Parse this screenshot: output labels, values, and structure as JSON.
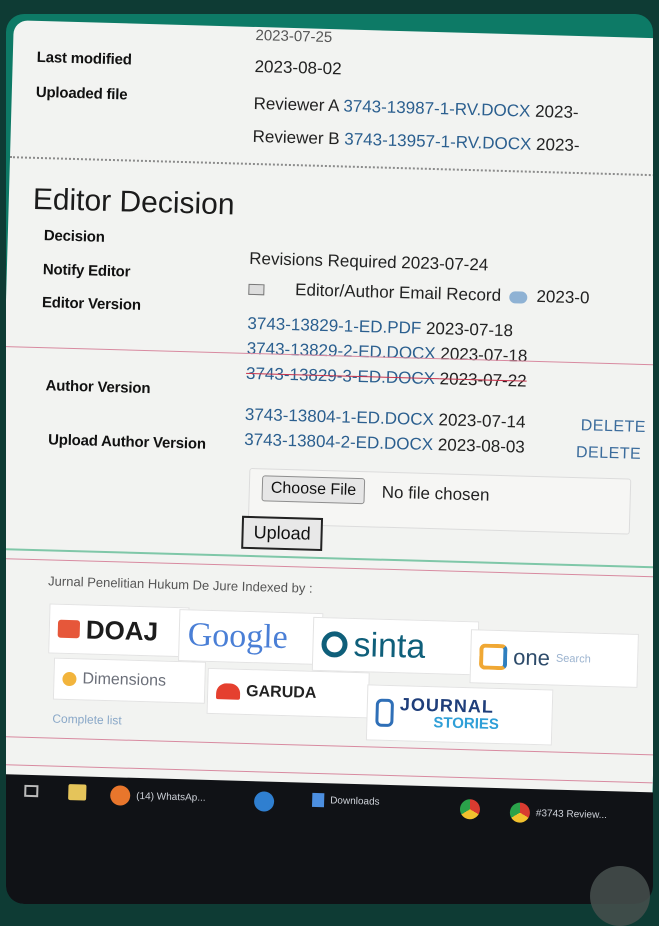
{
  "details": {
    "top_cut_date": "2023-07-25",
    "last_modified_label": "Last modified",
    "last_modified_value": "2023-08-02",
    "uploaded_file_label": "Uploaded file",
    "reviewers": [
      {
        "name": "Reviewer A",
        "file": "3743-13987-1-RV.DOCX",
        "date": "2023-"
      },
      {
        "name": "Reviewer B",
        "file": "3743-13957-1-RV.DOCX",
        "date": "2023-"
      }
    ]
  },
  "editor_decision": {
    "heading": "Editor Decision",
    "decision_label": "Decision",
    "decision_value": "Revisions Required 2023-07-24",
    "notify_label": "Notify Editor",
    "notify_value": "Editor/Author Email Record",
    "notify_date": "2023-0",
    "editor_version_label": "Editor Version",
    "editor_versions": [
      {
        "file": "3743-13829-1-ED.PDF",
        "date": "2023-07-18"
      },
      {
        "file": "3743-13829-2-ED.DOCX",
        "date": "2023-07-18"
      },
      {
        "file": "3743-13829-3-ED.DOCX",
        "date": "2023-07-22"
      }
    ],
    "author_version_label": "Author Version",
    "author_versions": [
      {
        "file": "3743-13804-1-ED.DOCX",
        "date": "2023-07-14",
        "action": "DELETE"
      },
      {
        "file": "3743-13804-2-ED.DOCX",
        "date": "2023-08-03",
        "action": "DELETE"
      }
    ],
    "upload_label": "Upload Author Version",
    "choose_file_label": "Choose File",
    "no_file_text": "No file chosen",
    "upload_button": "Upload"
  },
  "footer": {
    "indexed_by": "Jurnal Penelitian Hukum De Jure Indexed by :",
    "logos": [
      "DOAJ",
      "Google",
      "sinta",
      "one",
      "Dimensions",
      "GARUDA",
      "JOURNAL",
      "STORIES"
    ],
    "onesearch_small": "Search",
    "complete_list": "Complete list"
  },
  "taskbar": {
    "whatsapp": "(14) WhatsAp...",
    "downloads": "Downloads",
    "review_tab": "#3743 Review..."
  },
  "colors": {
    "link": "#2b5f8f",
    "doaj": "#e6573a",
    "sinta": "#0f5f7a",
    "garuda": "#e5402f"
  }
}
